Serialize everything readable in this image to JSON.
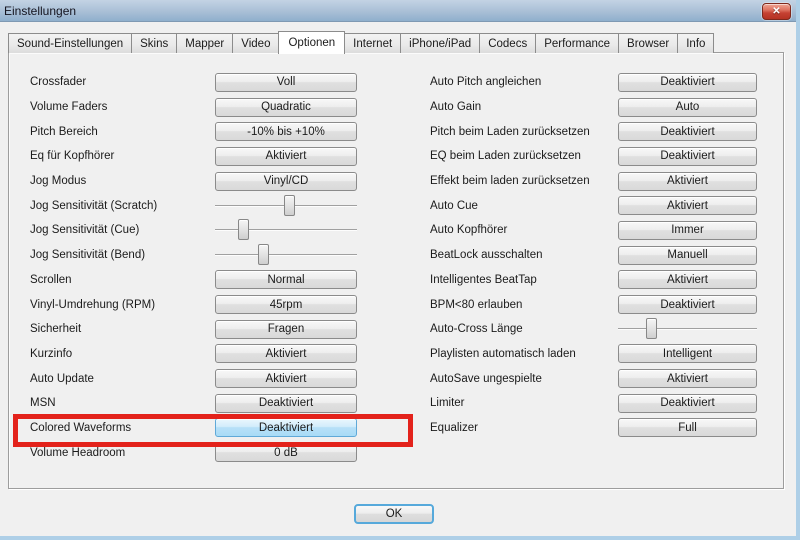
{
  "window": {
    "title": "Einstellungen",
    "close_icon": "✕"
  },
  "tabs": {
    "active_index": 4,
    "items": [
      "Sound-Einstellungen",
      "Skins",
      "Mapper",
      "Video",
      "Optionen",
      "Internet",
      "iPhone/iPad",
      "Codecs",
      "Performance",
      "Browser",
      "Info"
    ]
  },
  "settings": {
    "left": [
      {
        "label": "Crossfader",
        "type": "button",
        "value": "Voll"
      },
      {
        "label": "Volume Faders",
        "type": "button",
        "value": "Quadratic"
      },
      {
        "label": "Pitch Bereich",
        "type": "button",
        "value": "-10% bis +10%"
      },
      {
        "label": "Eq für Kopfhörer",
        "type": "button",
        "value": "Aktiviert"
      },
      {
        "label": "Jog Modus",
        "type": "button",
        "value": "Vinyl/CD"
      },
      {
        "label": "Jog Sensitivität (Scratch)",
        "type": "slider",
        "percent": 52
      },
      {
        "label": "Jog Sensitivität (Cue)",
        "type": "slider",
        "percent": 20
      },
      {
        "label": "Jog Sensitivität (Bend)",
        "type": "slider",
        "percent": 34
      },
      {
        "label": "Scrollen",
        "type": "button",
        "value": "Normal"
      },
      {
        "label": "Vinyl-Umdrehung (RPM)",
        "type": "button",
        "value": "45rpm"
      },
      {
        "label": "Sicherheit",
        "type": "button",
        "value": "Fragen"
      },
      {
        "label": "Kurzinfo",
        "type": "button",
        "value": "Aktiviert"
      },
      {
        "label": "Auto Update",
        "type": "button",
        "value": "Aktiviert"
      },
      {
        "label": "MSN",
        "type": "button",
        "value": "Deaktiviert"
      },
      {
        "label": "Colored Waveforms",
        "type": "button",
        "value": "Deaktiviert",
        "highlighted": true
      },
      {
        "label": "Volume Headroom",
        "type": "button",
        "value": "0 dB"
      }
    ],
    "right": [
      {
        "label": "Auto Pitch angleichen",
        "type": "button",
        "value": "Deaktiviert"
      },
      {
        "label": "Auto Gain",
        "type": "button",
        "value": "Auto"
      },
      {
        "label": "Pitch beim Laden zurücksetzen",
        "type": "button",
        "value": "Deaktiviert"
      },
      {
        "label": "EQ beim Laden zurücksetzen",
        "type": "button",
        "value": "Deaktiviert"
      },
      {
        "label": "Effekt beim laden zurücksetzen",
        "type": "button",
        "value": "Aktiviert"
      },
      {
        "label": "Auto Cue",
        "type": "button",
        "value": "Aktiviert"
      },
      {
        "label": "Auto Kopfhörer",
        "type": "button",
        "value": "Immer"
      },
      {
        "label": "BeatLock ausschalten",
        "type": "button",
        "value": "Manuell"
      },
      {
        "label": "Intelligentes BeatTap",
        "type": "button",
        "value": "Aktiviert"
      },
      {
        "label": "BPM<80 erlauben",
        "type": "button",
        "value": "Deaktiviert"
      },
      {
        "label": "Auto-Cross Länge",
        "type": "slider",
        "percent": 24
      },
      {
        "label": "Playlisten automatisch laden",
        "type": "button",
        "value": "Intelligent"
      },
      {
        "label": "AutoSave ungespielte",
        "type": "button",
        "value": "Aktiviert"
      },
      {
        "label": "Limiter",
        "type": "button",
        "value": "Deaktiviert"
      },
      {
        "label": "Equalizer",
        "type": "button",
        "value": "Full"
      }
    ]
  },
  "annotation": {
    "highlighted_setting": "Colored Waveforms",
    "color": "#e3221b"
  },
  "footer": {
    "ok_label": "OK"
  },
  "colors": {
    "titlebar_top": "#c3d3e4",
    "titlebar_bottom": "#8fafcd",
    "highlight_button_bg": "#a8dbf6",
    "highlight_button_border": "#5fa9d8",
    "window_border": "#aecfe7"
  }
}
